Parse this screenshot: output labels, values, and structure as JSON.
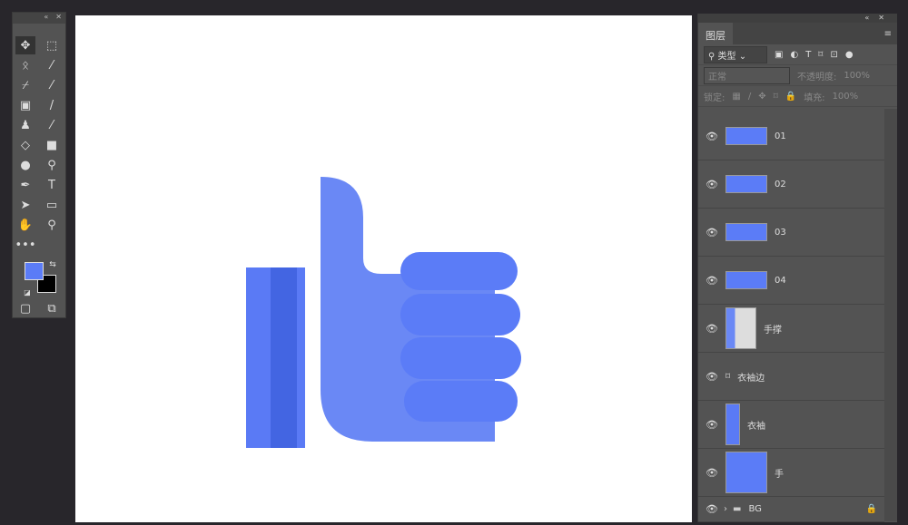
{
  "toolbar": {
    "tools": [
      "move",
      "marquee",
      "lasso",
      "magic-wand",
      "crop",
      "eyedropper",
      "healing",
      "brush",
      "stamp",
      "history-brush",
      "eraser",
      "gradient",
      "blur",
      "dodge",
      "pen",
      "type",
      "path-select",
      "rectangle",
      "hand",
      "zoom",
      "more"
    ],
    "foreground_color": "#5b7cf7",
    "background_color": "#000000",
    "type_glyph": "T"
  },
  "layers_panel": {
    "tab": "图层",
    "filter": "类型",
    "blend_mode": "正常",
    "opacity_label": "不透明度:",
    "opacity": "100%",
    "lock_label": "锁定:",
    "fill_label": "填充:",
    "fill": "100%",
    "layers": [
      {
        "name": "01"
      },
      {
        "name": "02"
      },
      {
        "name": "03"
      },
      {
        "name": "04"
      },
      {
        "name": "手撑"
      },
      {
        "name": "衣袖边"
      },
      {
        "name": "衣袖"
      },
      {
        "name": "手"
      }
    ],
    "group": {
      "name": "BG"
    }
  },
  "colors": {
    "sleeve": "#5a7af5",
    "sleeve_stripe": "#4365e2",
    "thumb": "#6a88f5",
    "fingers": "#5b7cf7"
  }
}
